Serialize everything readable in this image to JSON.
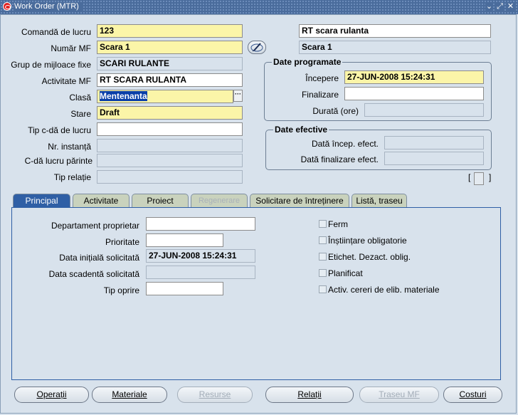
{
  "window": {
    "title": "Work Order (MTR)",
    "controls": [
      "minimize-icon",
      "maximize-icon",
      "close-icon"
    ]
  },
  "header": {
    "comanda_label": "Comandă de lucru",
    "comanda_value": "123",
    "numar_mf_label": "Număr MF",
    "numar_mf_value": "Scara 1",
    "grup_label": "Grup de mijloace fixe",
    "grup_value": "SCARI RULANTE",
    "activitate_label": "Activitate MF",
    "activitate_value": "RT SCARA RULANTA",
    "clasa_label": "Clasă",
    "clasa_value": "Mentenanta",
    "stare_label": "Stare",
    "stare_value": "Draft",
    "tip_cda_label": "Tip c-dă de lucru",
    "tip_cda_value": "",
    "nr_instanta_label": "Nr. instanță",
    "nr_instanta_value": "",
    "cda_parinte_label": "C-dă lucru părinte",
    "cda_parinte_value": "",
    "tip_relatie_label": "Tip relație",
    "tip_relatie_value": "",
    "description_value": "RT scara rulanta",
    "asset_desc_value": "Scara 1"
  },
  "scheduled": {
    "title": "Date programate",
    "start_label": "Începere",
    "start_value": "27-JUN-2008 15:24:31",
    "end_label": "Finalizare",
    "end_value": "",
    "duration_label": "Durată (ore)",
    "duration_value": ""
  },
  "actual": {
    "title": "Date efective",
    "start_label": "Dată încep. efect.",
    "start_value": "",
    "end_label": "Dată finalizare efect.",
    "end_value": ""
  },
  "indicator": {
    "left": "[",
    "right": "]"
  },
  "tabs": [
    "Principal",
    "Activitate",
    "Proiect",
    "Regenerare",
    "Solicitare de întreținere",
    "Listă, traseu"
  ],
  "principal": {
    "departament_label": "Departament proprietar",
    "departament_value": "",
    "prioritate_label": "Prioritate",
    "prioritate_value": "",
    "data_initiala_label": "Data inițială solicitată",
    "data_initiala_value": "27-JUN-2008 15:24:31",
    "data_scadenta_label": "Data scadentă solicitată",
    "data_scadenta_value": "",
    "tip_oprire_label": "Tip oprire",
    "tip_oprire_value": "",
    "checkboxes": [
      "Ferm",
      "Înștiințare obligatorie",
      "Etichet. Dezact. oblig.",
      "Planificat",
      "Activ. cereri de elib. materiale"
    ]
  },
  "buttons": {
    "operatii": "Operații",
    "materiale": "Materiale",
    "resurse": "Resurse",
    "relatii": "Relații",
    "traseu_mf": "Traseu MF",
    "costuri": "Costuri"
  }
}
